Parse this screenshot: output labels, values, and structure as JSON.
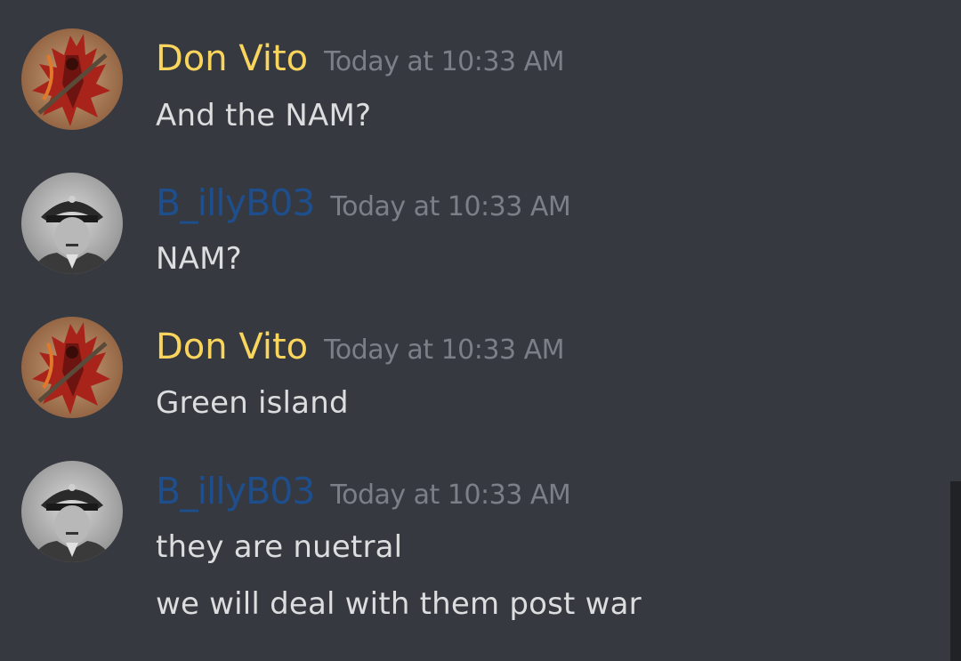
{
  "messages": [
    {
      "author": "Don Vito",
      "timestamp": "Today at 10:33 AM",
      "avatar": "demon-warrior-avatar",
      "lines": [
        "And the NAM?"
      ]
    },
    {
      "author": "B_illyB03",
      "timestamp": "Today at 10:33 AM",
      "avatar": "officer-portrait-avatar",
      "lines": [
        "NAM?"
      ]
    },
    {
      "author": "Don Vito",
      "timestamp": "Today at 10:33 AM",
      "avatar": "demon-warrior-avatar",
      "lines": [
        "Green island"
      ]
    },
    {
      "author": "B_illyB03",
      "timestamp": "Today at 10:33 AM",
      "avatar": "officer-portrait-avatar",
      "lines": [
        "they are nuetral",
        "we will deal with them post war"
      ]
    }
  ],
  "colors": {
    "background": "#36393f",
    "don_vito_name": "#fad55d",
    "billy_name": "#1e4e8c",
    "timestamp": "#7b7f87",
    "text": "#dcddde"
  }
}
